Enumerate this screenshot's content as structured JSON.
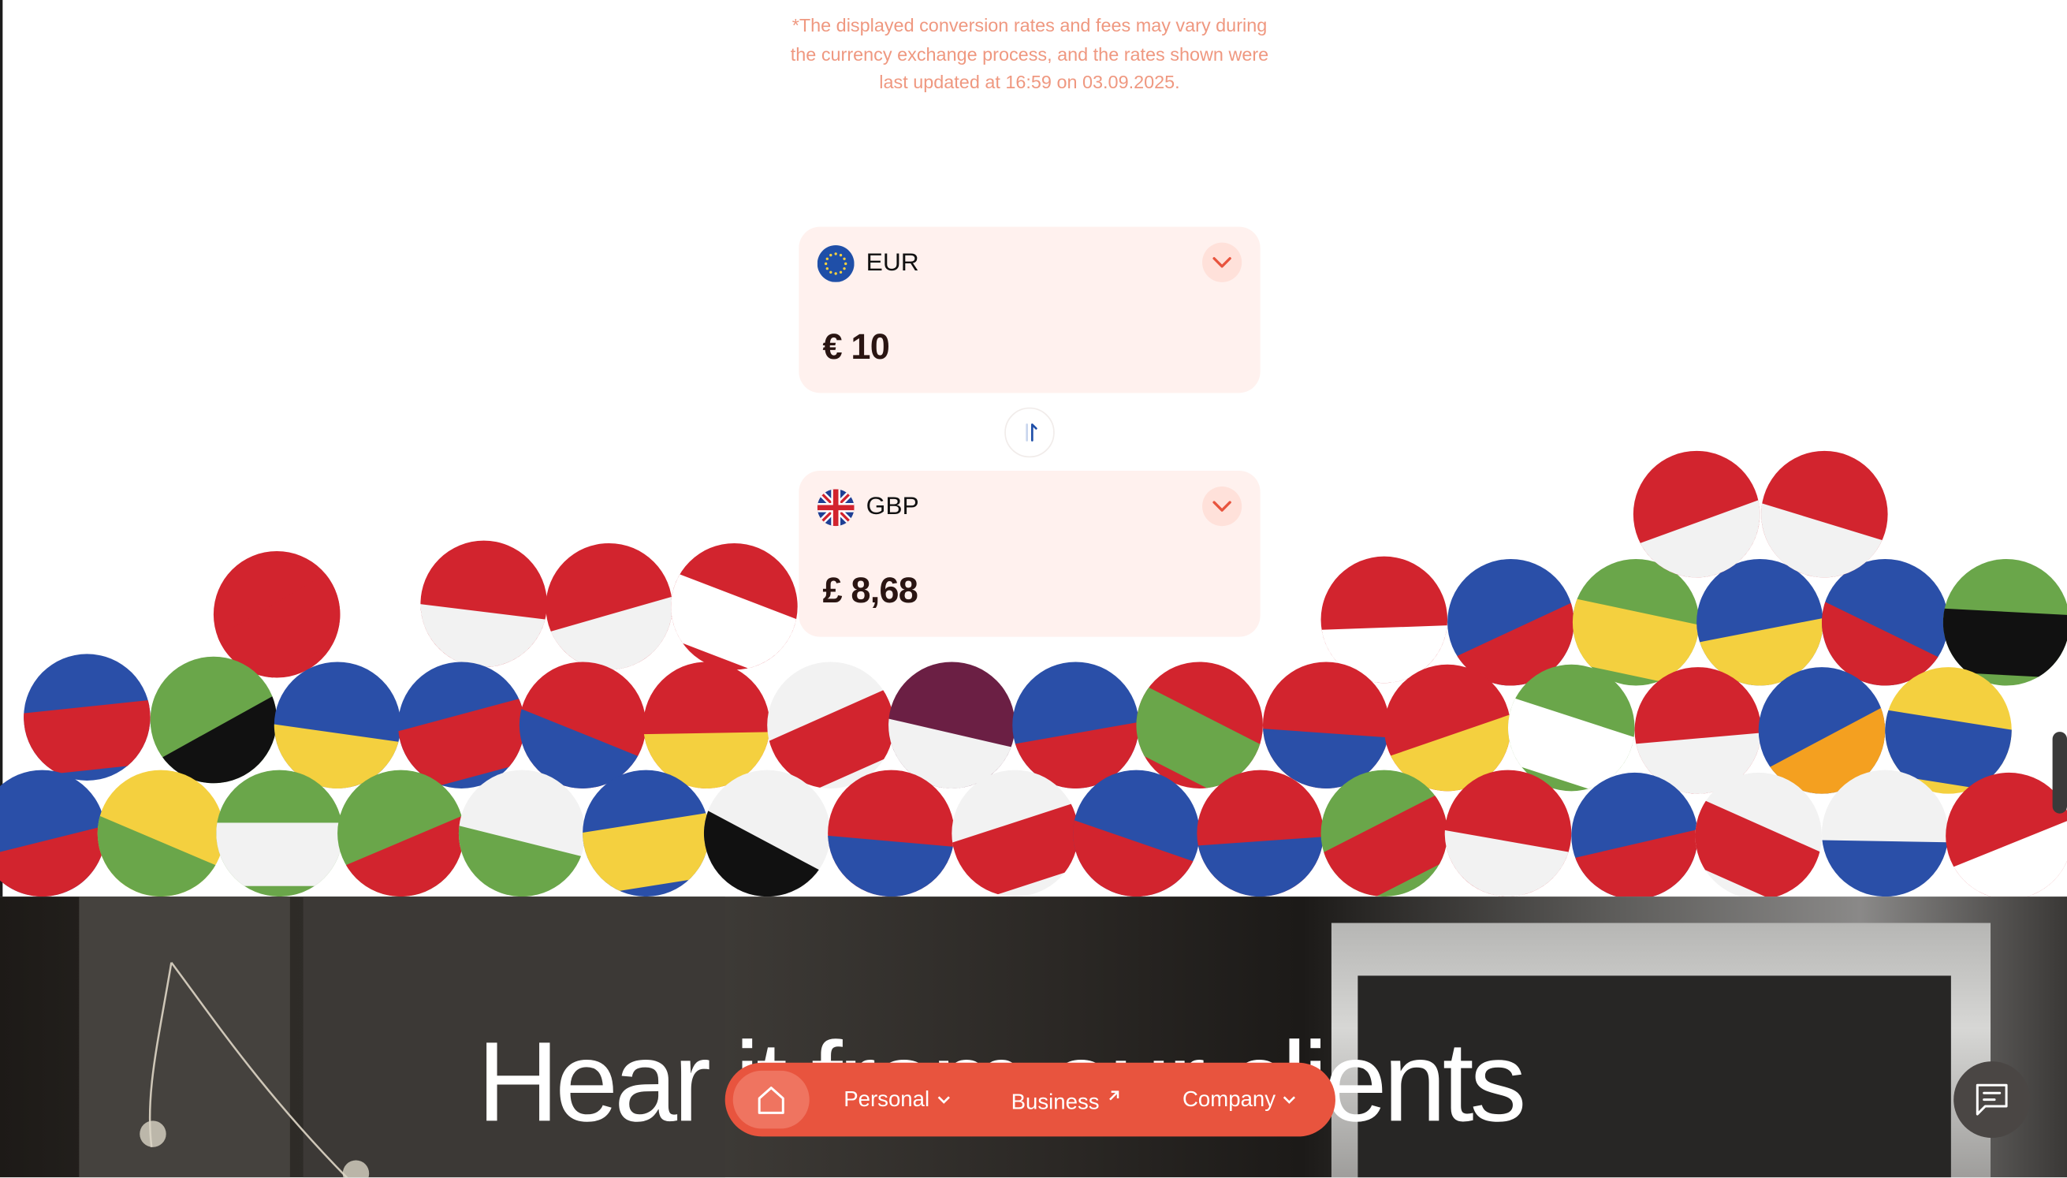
{
  "disclaimer": "*The displayed conversion rates and fees may vary during the currency exchange process, and the rates shown were last updated at 16:59 on 03.09.2025.",
  "converter": {
    "from": {
      "currency": "EUR",
      "amount": "€ 10",
      "flag": "eu-flag-icon"
    },
    "to": {
      "currency": "GBP",
      "amount": "£ 8,68",
      "flag": "uk-flag-icon"
    },
    "swap_icon": "swap-arrows-icon",
    "dropdown_icon": "chevron-down-icon"
  },
  "flags": [
    "tunisia",
    "austria",
    "bahrain",
    "switzerland",
    "hong-kong",
    "czechia",
    "brazil",
    "sweden",
    "france",
    "uae",
    "usa",
    "indonesia",
    "france",
    "kuwait",
    "eu",
    "australia",
    "taiwan",
    "morocco",
    "japan",
    "qatar",
    "iceland",
    "oman",
    "mongolia",
    "vietnam",
    "saudi-arabia",
    "singapore",
    "bosnia",
    "colombia",
    "uk",
    "ghana",
    "nigeria",
    "burundi",
    "hungary",
    "ukraine",
    "jordan",
    "chile",
    "canada",
    "malaysia",
    "norway",
    "south-africa",
    "peru",
    "new-zealand",
    "india",
    "south-korea",
    "denmark"
  ],
  "section": {
    "headline": "Hear it from our clients"
  },
  "nav": {
    "home_icon": "home-icon",
    "items": [
      {
        "label": "Personal",
        "icon": "chevron-down-icon"
      },
      {
        "label": "Business",
        "icon": "arrow-up-right-icon"
      },
      {
        "label": "Company",
        "icon": "chevron-down-icon"
      }
    ]
  },
  "chat_icon": "chat-icon",
  "colors": {
    "accent": "#e8543e",
    "card_bg": "#fff1ee",
    "disclaimer": "#ef9880"
  }
}
